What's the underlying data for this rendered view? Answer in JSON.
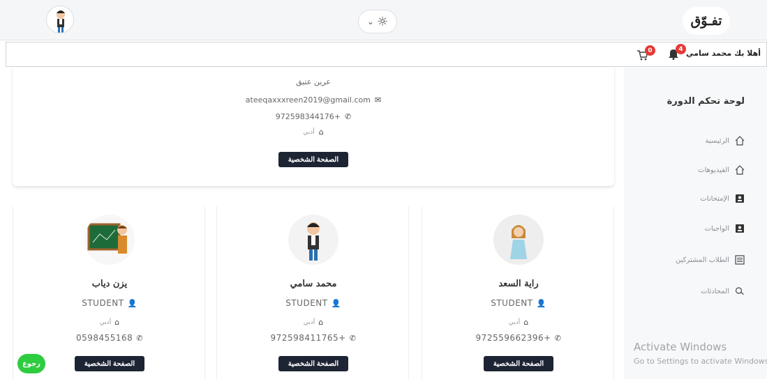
{
  "header": {
    "brand": "تفـوّق",
    "theme_chevron": "⌄",
    "theme_icon": "sun-icon"
  },
  "subbar": {
    "greeting": "أهلا بك محمد سامي",
    "notifications_count": "4",
    "cart_count": "0"
  },
  "sidebar": {
    "title": "لوحة تحكم الدورة",
    "items": [
      {
        "label": "الرئيسية",
        "icon": "home-icon"
      },
      {
        "label": "الفيديوهات",
        "icon": "home-icon"
      },
      {
        "label": "الإمتحانات",
        "icon": "id-card-icon"
      },
      {
        "label": "الواجبات",
        "icon": "id-card-icon"
      },
      {
        "label": "الطلاب المشتركين",
        "icon": "list-icon"
      },
      {
        "label": "المحادثات",
        "icon": "chat-icon"
      }
    ]
  },
  "windows_watermark": {
    "title": "Activate Windows",
    "subtitle": "Go to Settings to activate Windows."
  },
  "top_card": {
    "name": "عرين عتيق",
    "email": "ateeqaxxxreen2019@gmail.com",
    "phone": "972598344176+",
    "spec": "أدبي",
    "button": "الصفحة الشخصية"
  },
  "students": [
    {
      "name": "راية السعد",
      "role": "STUDENT",
      "spec": "أدبي",
      "phone": "972559662396+",
      "button": "الصفحة الشخصية"
    },
    {
      "name": "محمد سامي",
      "role": "STUDENT",
      "spec": "أدبي",
      "phone": "972598411765+",
      "button": "الصفحة الشخصية"
    },
    {
      "name": "يزن دياب",
      "role": "STUDENT",
      "spec": "أدبي",
      "phone": "0598455168",
      "button": "الصفحة الشخصية"
    }
  ],
  "back_button": "رجوع",
  "colors": {
    "dark_button": "#1d2433",
    "back_button": "#2ecc40",
    "badge": "#e53935"
  }
}
